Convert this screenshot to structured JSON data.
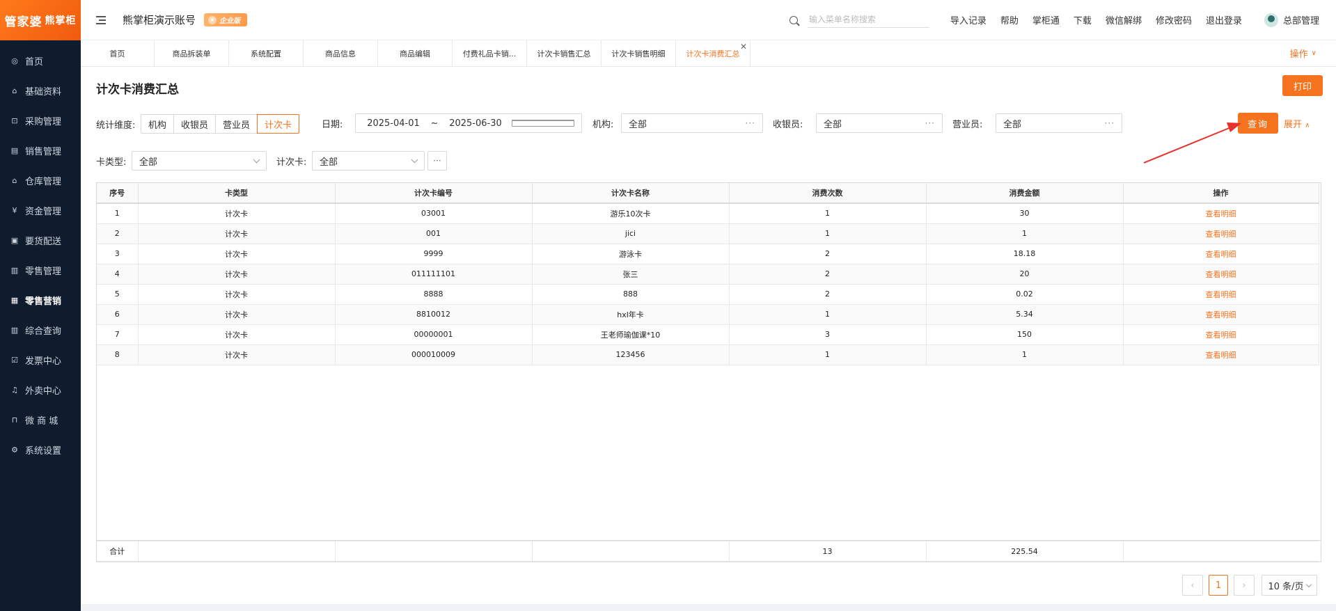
{
  "brand": {
    "logo": "管家婆",
    "logo_sub": "熊掌柜"
  },
  "sidebar": {
    "items": [
      {
        "label": "首页"
      },
      {
        "label": "基础资料"
      },
      {
        "label": "采购管理"
      },
      {
        "label": "销售管理"
      },
      {
        "label": "仓库管理"
      },
      {
        "label": "资金管理"
      },
      {
        "label": "要货配送"
      },
      {
        "label": "零售管理"
      },
      {
        "label": "零售营销",
        "active": true
      },
      {
        "label": "综合查询"
      },
      {
        "label": "发票中心"
      },
      {
        "label": "外卖中心"
      },
      {
        "label": "微 商 城"
      },
      {
        "label": "系统设置"
      }
    ]
  },
  "header": {
    "account": "熊掌柜演示账号",
    "badge": "企业版",
    "search_placeholder": "输入菜单名称搜索",
    "links": [
      "导入记录",
      "帮助",
      "掌柜通",
      "下载",
      "微信解绑",
      "修改密码",
      "退出登录"
    ],
    "user": "总部管理"
  },
  "tabs": {
    "items": [
      "首页",
      "商品拆装单",
      "系统配置",
      "商品信息",
      "商品编辑",
      "付费礼品卡销...",
      "计次卡销售汇总",
      "计次卡销售明细",
      "计次卡消费汇总"
    ],
    "active_index": 8,
    "ops_label": "操作"
  },
  "page": {
    "title": "计次卡消费汇总",
    "print_label": "打印",
    "query_label": "查询",
    "expand_label": "展开"
  },
  "filters": {
    "dimension_label": "统计维度:",
    "dimensions": [
      "机构",
      "收银员",
      "营业员",
      "计次卡"
    ],
    "dimension_selected": "计次卡",
    "date_label": "日期:",
    "date_from": "2025-04-01",
    "date_sep": "~",
    "date_to": "2025-06-30",
    "org_label": "机构:",
    "org_value": "全部",
    "cashier_label": "收银员:",
    "cashier_value": "全部",
    "salesperson_label": "营业员:",
    "salesperson_value": "全部",
    "cardtype_label": "卡类型:",
    "cardtype_value": "全部",
    "card_label": "计次卡:",
    "card_value": "全部"
  },
  "table": {
    "columns": [
      "序号",
      "卡类型",
      "计次卡编号",
      "计次卡名称",
      "消费次数",
      "消费金额",
      "操作"
    ],
    "rows": [
      [
        "1",
        "计次卡",
        "03001",
        "游乐10次卡",
        "1",
        "30",
        "查看明细"
      ],
      [
        "2",
        "计次卡",
        "001",
        "jici",
        "1",
        "1",
        "查看明细"
      ],
      [
        "3",
        "计次卡",
        "9999",
        "游泳卡",
        "2",
        "18.18",
        "查看明细"
      ],
      [
        "4",
        "计次卡",
        "011111101",
        "张三",
        "2",
        "20",
        "查看明细"
      ],
      [
        "5",
        "计次卡",
        "8888",
        "888",
        "2",
        "0.02",
        "查看明细"
      ],
      [
        "6",
        "计次卡",
        "8810012",
        "hxl年卡",
        "1",
        "5.34",
        "查看明细"
      ],
      [
        "7",
        "计次卡",
        "00000001",
        "王老师瑜伽课*10",
        "3",
        "150",
        "查看明细"
      ],
      [
        "8",
        "计次卡",
        "000010009",
        "123456",
        "1",
        "1",
        "查看明细"
      ]
    ],
    "footer": {
      "label": "合计",
      "count": "13",
      "amount": "225.54"
    }
  },
  "pager": {
    "current": "1",
    "page_size": "10 条/页"
  },
  "colors": {
    "accent": "#f5731e",
    "sidebar_bg": "#0f1c2e",
    "annotation": "#e8312a"
  }
}
